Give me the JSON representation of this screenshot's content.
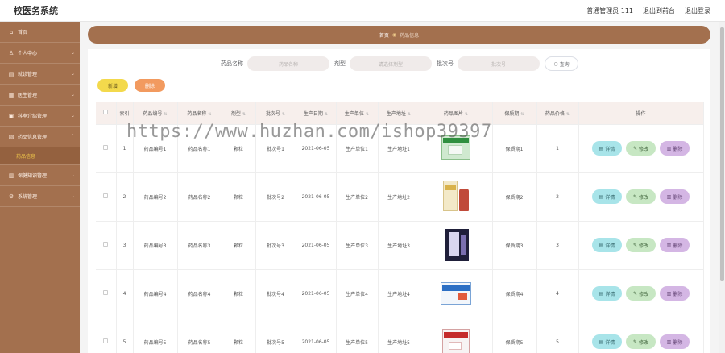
{
  "app": {
    "brand": "校医务系统",
    "user_text": "普通管理员 111",
    "back_link": "退出到前台",
    "logout_link": "退出登录"
  },
  "sidebar": {
    "items": [
      {
        "label": "首页",
        "icon": "home-icon",
        "has_arrow": false
      },
      {
        "label": "个人中心",
        "icon": "user-icon",
        "has_arrow": true
      },
      {
        "label": "就诊管理",
        "icon": "clipboard-icon",
        "has_arrow": true
      },
      {
        "label": "医生管理",
        "icon": "doctor-icon",
        "has_arrow": true
      },
      {
        "label": "科室介绍管理",
        "icon": "building-icon",
        "has_arrow": true
      },
      {
        "label": "药品信息管理",
        "icon": "pill-icon",
        "has_arrow": true,
        "expanded": true,
        "sub_item": "药品信息"
      },
      {
        "label": "保健知识管理",
        "icon": "book-icon",
        "has_arrow": true
      },
      {
        "label": "系统管理",
        "icon": "gear-icon",
        "has_arrow": true
      }
    ]
  },
  "breadcrumb": {
    "home": "首页",
    "current": "药品信息"
  },
  "search": {
    "name_label": "药品名称",
    "name_placeholder": "药品名称",
    "type_label": "剂型",
    "type_placeholder": "请选择剂型",
    "batch_label": "批次号",
    "batch_placeholder": "批次号",
    "query_label": "查询"
  },
  "actions": {
    "add_label": "新增",
    "delete_label": "删除"
  },
  "watermark": "https://www.huzhan.com/ishop39397",
  "table": {
    "headers": [
      "索引",
      "药品编号",
      "药品名称",
      "剂型",
      "批次号",
      "生产日期",
      "生产单位",
      "生产地址",
      "药品图片",
      "保质期",
      "药品价格",
      "操作"
    ],
    "rows": [
      {
        "index": "1",
        "code": "药品编号1",
        "name": "药品名称1",
        "form": "颗粒",
        "batch": "批次号1",
        "date": "2021-06-05",
        "unit": "生产单位1",
        "address": "生产地址1",
        "shelf": "保质期1",
        "price": "1"
      },
      {
        "index": "2",
        "code": "药品编号2",
        "name": "药品名称2",
        "form": "颗粒",
        "batch": "批次号2",
        "date": "2021-06-05",
        "unit": "生产单位2",
        "address": "生产地址2",
        "shelf": "保质期2",
        "price": "2"
      },
      {
        "index": "3",
        "code": "药品编号3",
        "name": "药品名称3",
        "form": "颗粒",
        "batch": "批次号3",
        "date": "2021-06-05",
        "unit": "生产单位3",
        "address": "生产地址3",
        "shelf": "保质期3",
        "price": "3"
      },
      {
        "index": "4",
        "code": "药品编号4",
        "name": "药品名称4",
        "form": "颗粒",
        "batch": "批次号4",
        "date": "2021-06-05",
        "unit": "生产单位4",
        "address": "生产地址4",
        "shelf": "保质期4",
        "price": "4"
      },
      {
        "index": "5",
        "code": "药品编号5",
        "name": "药品名称5",
        "form": "颗粒",
        "batch": "批次号5",
        "date": "2021-06-05",
        "unit": "生产单位5",
        "address": "生产地址5",
        "shelf": "保质期5",
        "price": "5"
      }
    ],
    "op_labels": {
      "detail": "详情",
      "edit": "修改",
      "remove": "删除"
    }
  },
  "colors": {
    "sidebar": "#a3704e",
    "breadcrumb": "#a3704e",
    "add_button": "#f3d94c",
    "delete_button": "#f29a5f",
    "detail_button": "#a8e4e9",
    "edit_button": "#c7e7c3",
    "remove_button": "#d4b6e4",
    "header_row": "#f7efec"
  }
}
